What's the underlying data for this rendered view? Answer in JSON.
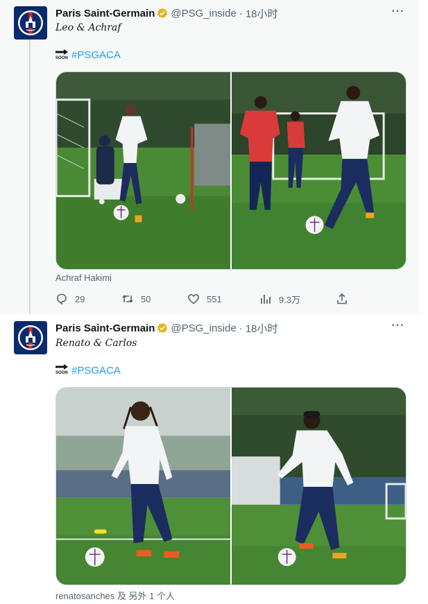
{
  "tweets": [
    {
      "author": {
        "name": "Paris Saint-Germain",
        "handle": "@PSG_inside",
        "dot": "·",
        "time": "18小时"
      },
      "text": "Leo & Achraf",
      "soon_label": "SOON",
      "hashtag": "#PSGACA",
      "tagged": "Achraf Hakimi",
      "stats": {
        "replies": "29",
        "retweets": "50",
        "likes": "551",
        "views": "9.3万"
      },
      "photos": [
        "messi-training-photo",
        "hakimi-training-photo"
      ]
    },
    {
      "author": {
        "name": "Paris Saint-Germain",
        "handle": "@PSG_inside",
        "dot": "·",
        "time": "18小时"
      },
      "text": "Renato & Carlos",
      "soon_label": "SOON",
      "hashtag": "#PSGACA",
      "tagged": "renatosanches 及 另外 1 个人",
      "photos": [
        "renato-training-photo",
        "carlos-training-photo"
      ]
    }
  ],
  "colors": {
    "link": "#1d9bf0",
    "muted": "#536471",
    "verified": "#e2b719",
    "psg_navy": "#0a2b6b",
    "psg_red": "#da291c"
  },
  "icons": [
    "reply-icon",
    "retweet-icon",
    "like-icon",
    "views-icon",
    "share-icon",
    "more-icon",
    "verified-badge-icon"
  ]
}
